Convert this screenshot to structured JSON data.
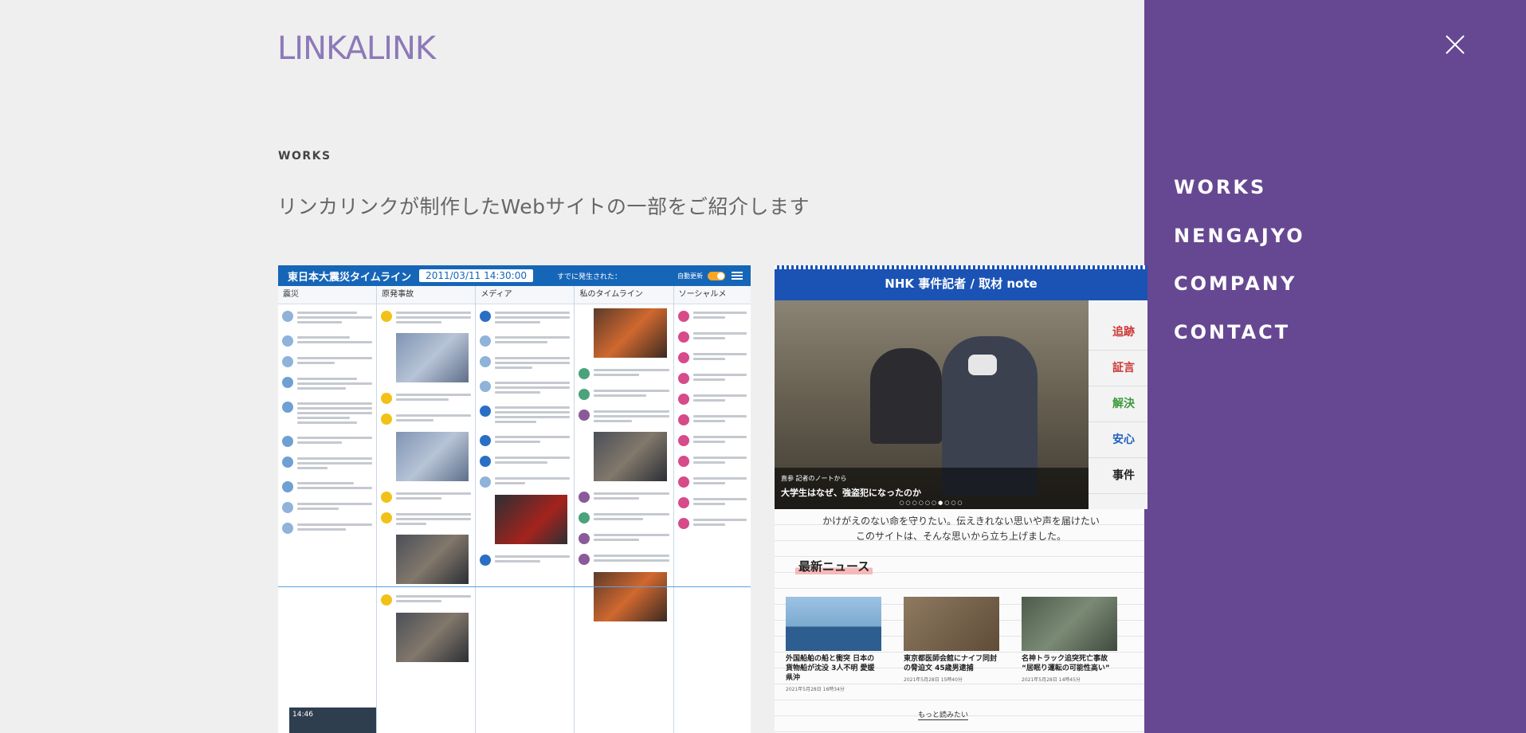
{
  "logo": {
    "text": "LINKALINK",
    "color": "#8d79b8"
  },
  "section": {
    "label": "WORKS",
    "intro": "リンカリンクが制作したWebサイトの一部をご紹介します"
  },
  "works": [
    {
      "app_title": "東日本大震災タイムライン",
      "date": "2011/03/11 14:30:00",
      "now_text": "すでに発生された：",
      "auto_label": "自動更新",
      "columns": [
        "震災",
        "原発事故",
        "メディア",
        "私のタイムライン",
        "ソーシャルメ"
      ],
      "clock": "14:46"
    },
    {
      "site_title": "NHK 事件記者 / 取材 note",
      "hero_small": "直参 記者のノートから",
      "hero_caption": "大学生はなぜ、強盗犯になったのか",
      "hero_dots": "○○○○○○●○○○",
      "side_rows": [
        "追跡",
        "証言",
        "解決",
        "安心",
        "事件"
      ],
      "lead_line1": "かけがえのない命を守りたい。伝えきれない思いや声を届けたい",
      "lead_line2": "このサイトは、そんな思いから立ち上げました。",
      "news_title": "最新ニュース",
      "news": [
        {
          "title": "外国船舶の船と衝突 日本の貨物船が沈没 3人不明 愛媛県沖",
          "date": "2021年5月28日 16時34分"
        },
        {
          "title": "東京都医師会館にナイフ同封の脅迫文 45歳男逮捕",
          "date": "2021年5月28日 15時40分"
        },
        {
          "title": "名神トラック追突死亡事故 “居眠り運転の可能性高い”",
          "date": "2021年5月28日 14時45分"
        }
      ],
      "more": "もっと読みたい"
    }
  ],
  "menu": {
    "items": [
      "WORKS",
      "NENGAJYO",
      "COMPANY",
      "CONTACT"
    ],
    "bg": "#664892"
  }
}
